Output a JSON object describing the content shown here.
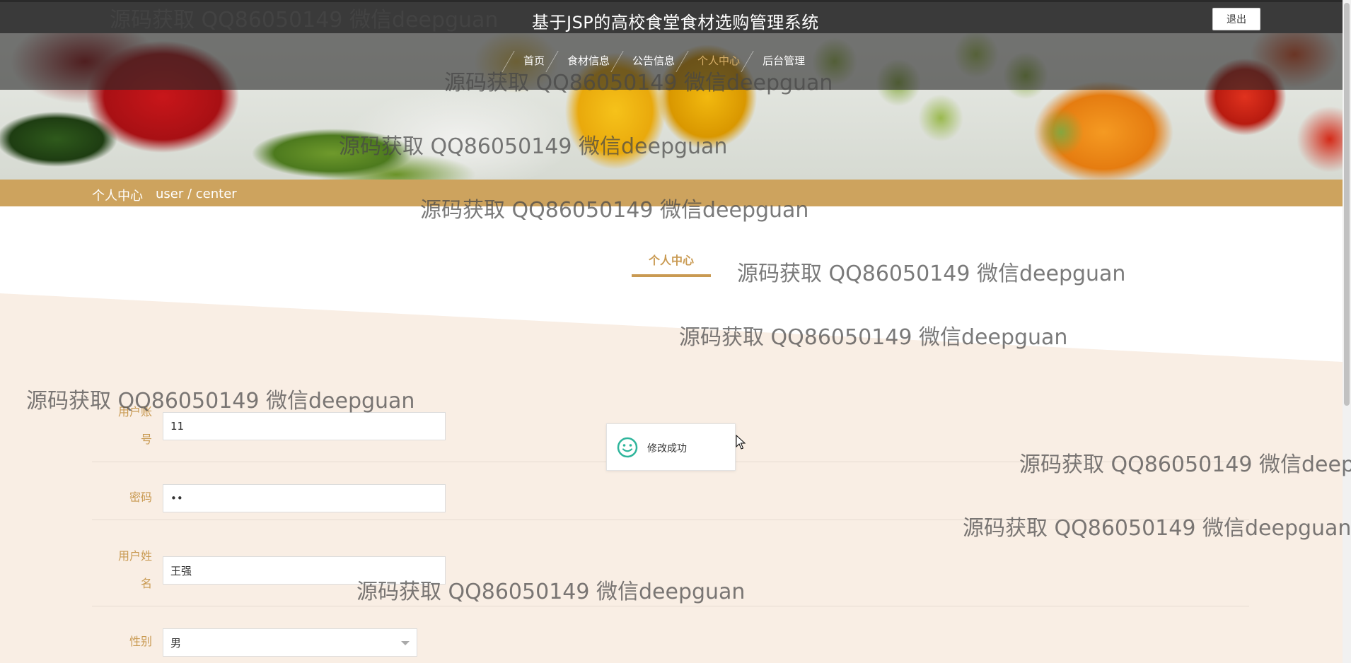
{
  "header": {
    "title": "基于JSP的高校食堂食材选购管理系统",
    "logout_label": "退出"
  },
  "nav": {
    "items": [
      {
        "label": "首页"
      },
      {
        "label": "食材信息"
      },
      {
        "label": "公告信息"
      },
      {
        "label": "个人中心"
      },
      {
        "label": "后台管理"
      }
    ],
    "active_index": 3
  },
  "breadcrumb": {
    "title": "个人中心",
    "subtitle": "user / center"
  },
  "section": {
    "tab_label": "个人中心"
  },
  "form": {
    "account_label_1": "用户账",
    "account_label_2": "号",
    "account_value": "11",
    "password_label": "密码",
    "password_value": "••",
    "name_label_1": "用户姓",
    "name_label_2": "名",
    "name_value": "王强",
    "gender_label": "性别",
    "gender_value": "男"
  },
  "toast": {
    "message": "修改成功",
    "icon": "smile-icon"
  },
  "colors": {
    "topbar": "#3a3a3a",
    "accent": "#c99a52",
    "crumb_bar": "#cda35e",
    "page_bg": "#f9eee4",
    "toast_icon": "#2fb59c"
  },
  "watermarks": [
    {
      "text": "源码获取 QQ86050149 微信deepguan"
    },
    {
      "text": "源码获取 QQ86050149 微信deepguan"
    },
    {
      "text": "源码获取 QQ86050149 微信deepguan"
    },
    {
      "text": "源码获取 QQ86050149 微信deepguan"
    },
    {
      "text": "源码获取 QQ86050149 微信deepguan"
    },
    {
      "text": "源码获取 QQ86050149 微信deepguan"
    },
    {
      "text": "源码获取 QQ86050149 微信deepguan"
    },
    {
      "text": "源码获取 QQ86050149 微信deepg"
    },
    {
      "text": "源码获取 QQ86050149 微信deepguan"
    },
    {
      "text": "源码获取 QQ86050149 微信deepguan"
    }
  ]
}
